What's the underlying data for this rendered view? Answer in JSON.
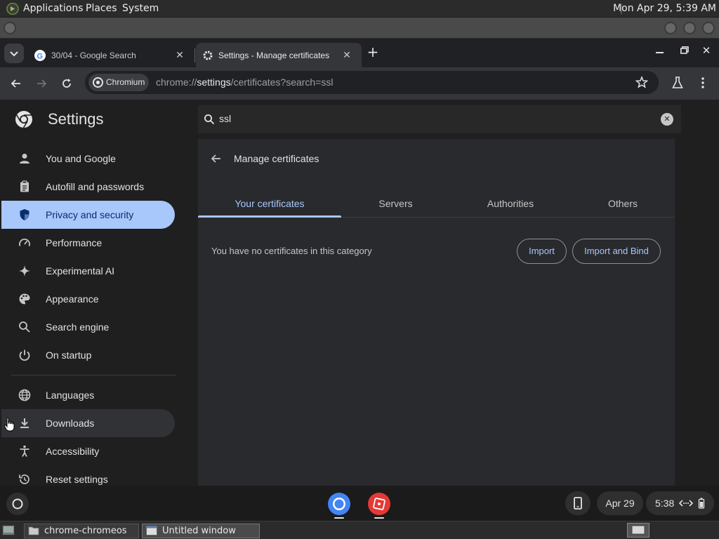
{
  "gnome_top": {
    "menus": [
      "Applications",
      "Places",
      "System"
    ],
    "clock": "Mon Apr 29,  5:39 AM"
  },
  "browser": {
    "tabs": [
      {
        "title": "30/04 - Google Search",
        "icon": "google-icon",
        "active": false
      },
      {
        "title": "Settings - Manage certificates",
        "icon": "settings-gear-icon",
        "active": true
      }
    ],
    "new_tab": "+",
    "chip_label": "Chromium",
    "url_scheme": "chrome://",
    "url_host": "settings",
    "url_path": "/certificates?search=ssl"
  },
  "settings": {
    "title": "Settings",
    "search_value": "ssl",
    "nav": [
      {
        "label": "You and Google",
        "icon": "person-icon"
      },
      {
        "label": "Autofill and passwords",
        "icon": "clipboard-icon"
      },
      {
        "label": "Privacy and security",
        "icon": "shield-icon",
        "active": true
      },
      {
        "label": "Performance",
        "icon": "speedometer-icon"
      },
      {
        "label": "Experimental AI",
        "icon": "sparkle-icon"
      },
      {
        "label": "Appearance",
        "icon": "palette-icon"
      },
      {
        "label": "Search engine",
        "icon": "search-icon"
      },
      {
        "label": "On startup",
        "icon": "power-icon"
      },
      {
        "label": "Languages",
        "icon": "globe-icon"
      },
      {
        "label": "Downloads",
        "icon": "download-icon",
        "hovered": true
      },
      {
        "label": "Accessibility",
        "icon": "accessibility-icon"
      },
      {
        "label": "Reset settings",
        "icon": "reset-icon"
      }
    ]
  },
  "certificates": {
    "page_title": "Manage certificates",
    "tabs": [
      "Your certificates",
      "Servers",
      "Authorities",
      "Others"
    ],
    "active_tab": "Your certificates",
    "empty_message": "You have no certificates in this category",
    "import_label": "Import",
    "import_bind_label": "Import and Bind"
  },
  "shelf": {
    "date": "Apr 29",
    "time": "5:38"
  },
  "gnome_bottom": {
    "tasks": [
      {
        "label": "chrome-chromeos",
        "active": false
      },
      {
        "label": "Untitled window",
        "active": true
      }
    ]
  },
  "colors": {
    "accent": "#a8c7fa",
    "active_nav_text": "#062e6f",
    "shelf_app_red": "#e53935",
    "shelf_app_blue": "#4285f4"
  }
}
